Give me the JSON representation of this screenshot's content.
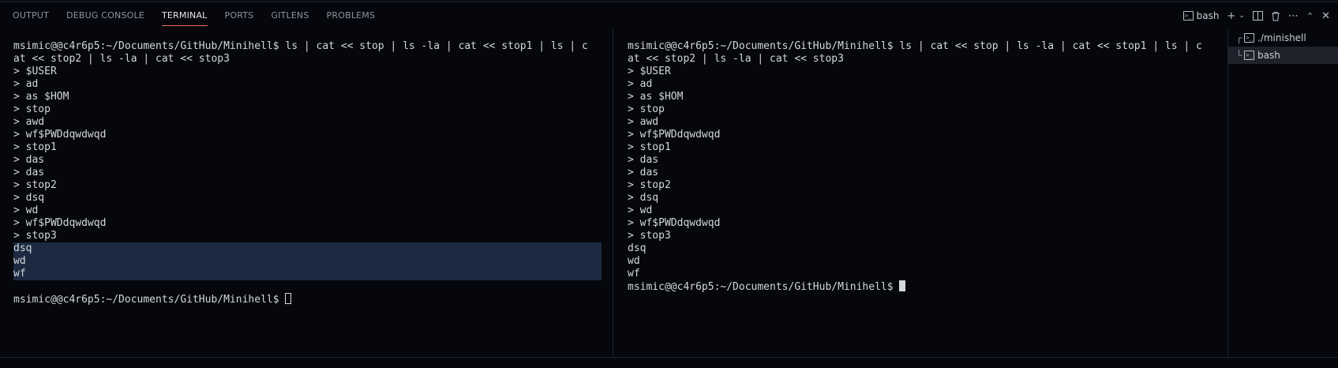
{
  "panel": {
    "tabs": [
      {
        "label": "OUTPUT"
      },
      {
        "label": "DEBUG CONSOLE"
      },
      {
        "label": "TERMINAL"
      },
      {
        "label": "PORTS"
      },
      {
        "label": "GITLENS"
      },
      {
        "label": "PROBLEMS"
      }
    ],
    "active_tab": "TERMINAL",
    "terminal_name": "bash",
    "colors": {
      "accent": "#e8714f",
      "selection": "#1b2a40",
      "background": "#05070c"
    }
  },
  "terminals": {
    "left": {
      "lines": [
        "msimic@@c4r6p5:~/Documents/GitHub/Minihell$ ls | cat << stop | ls -la | cat << stop1 | ls | c",
        "at << stop2 | ls -la | cat << stop3",
        "> $USER",
        "> ad",
        "> as $HOM",
        "> stop",
        "> awd",
        "> wf$PWDdqwdwqd",
        "> stop1",
        "> das",
        "> das",
        "> stop2",
        "> dsq",
        "> wd",
        "> wf$PWDdqwdwqd",
        "> stop3",
        "dsq",
        "wd",
        "wf",
        ""
      ],
      "prompt": "msimic@@c4r6p5:~/Documents/GitHub/Minihell$ "
    },
    "right": {
      "lines": [
        "msimic@@c4r6p5:~/Documents/GitHub/Minihell$ ls | cat << stop | ls -la | cat << stop1 | ls | c",
        "at << stop2 | ls -la | cat << stop3",
        "> $USER",
        "> ad",
        "> as $HOM",
        "> stop",
        "> awd",
        "> wf$PWDdqwdwqd",
        "> stop1",
        "> das",
        "> das",
        "> stop2",
        "> dsq",
        "> wd",
        "> wf$PWDdqwdwqd",
        "> stop3",
        "dsq",
        "wd",
        "wf"
      ],
      "prompt": "msimic@@c4r6p5:~/Documents/GitHub/Minihell$ "
    }
  },
  "terminal_list": [
    {
      "tree": "┌",
      "label": "./minishell"
    },
    {
      "tree": "└",
      "label": "bash"
    }
  ]
}
